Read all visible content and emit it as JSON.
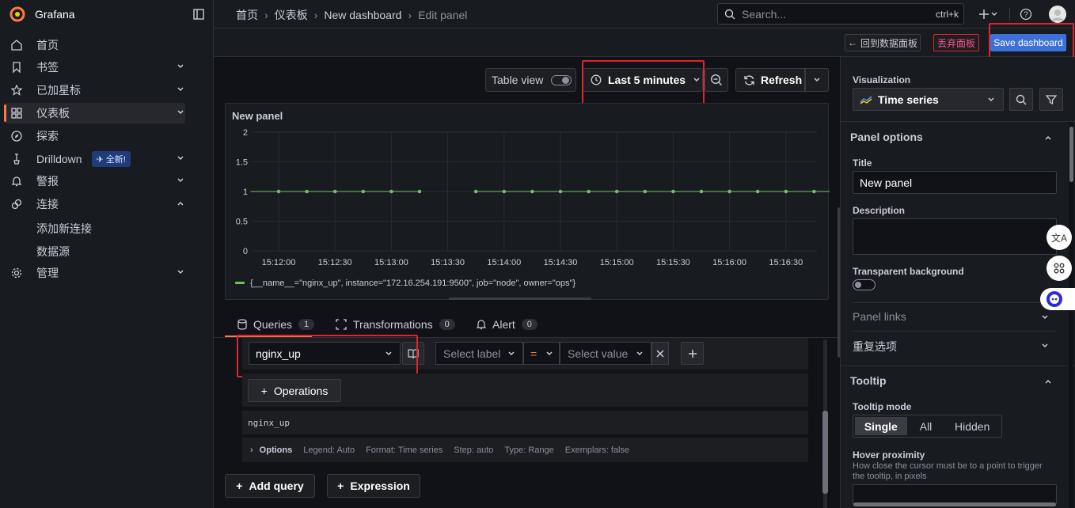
{
  "app": {
    "name": "Grafana"
  },
  "sidebar": {
    "items": [
      {
        "label": "首页",
        "icon": "home-icon"
      },
      {
        "label": "书签",
        "icon": "bookmark-icon"
      },
      {
        "label": "已加星标",
        "icon": "star-icon"
      },
      {
        "label": "仪表板",
        "icon": "dashboards-icon"
      },
      {
        "label": "探索",
        "icon": "compass-icon"
      },
      {
        "label": "Drilldown",
        "icon": "drilldown-icon",
        "badge": "全新!"
      },
      {
        "label": "警报",
        "icon": "bell-icon"
      },
      {
        "label": "连接",
        "icon": "link-icon"
      },
      {
        "label": "管理",
        "icon": "gear-icon"
      }
    ],
    "sub_items": [
      "添加新连接",
      "数据源"
    ]
  },
  "breadcrumb": [
    "首页",
    "仪表板",
    "New dashboard",
    "Edit panel"
  ],
  "search": {
    "placeholder": "Search...",
    "shortcut": "ctrl+k"
  },
  "toolbar": {
    "back_label": "回到数据面板",
    "discard_label": "丢弃面板",
    "save_label": "Save dashboard"
  },
  "panel_toolbar": {
    "table_view_label": "Table view",
    "time_range": "Last 5 minutes",
    "refresh_label": "Refresh"
  },
  "panel": {
    "title": "New panel"
  },
  "chart_data": {
    "type": "line",
    "title": "New panel",
    "x_ticks": [
      "15:12:00",
      "15:12:30",
      "15:13:00",
      "15:13:30",
      "15:14:00",
      "15:14:30",
      "15:15:00",
      "15:15:30",
      "15:16:00",
      "15:16:30"
    ],
    "y_ticks": [
      "0",
      "0.5",
      "1",
      "1.5",
      "2"
    ],
    "ylim": [
      0,
      2
    ],
    "series": [
      {
        "name": "{__name__=\"nginx_up\", instance=\"172.16.254.191:9500\", job=\"node\", owner=\"ops\"}",
        "color": "#73bf69",
        "segments": [
          {
            "x": [
              "15:11:45",
              "15:12:00",
              "15:12:15",
              "15:12:30",
              "15:12:45",
              "15:13:00",
              "15:13:15"
            ],
            "y": [
              1,
              1,
              1,
              1,
              1,
              1,
              1
            ]
          },
          {
            "x": [
              "15:13:45",
              "15:14:00",
              "15:14:15",
              "15:14:30",
              "15:14:45",
              "15:15:00",
              "15:15:15",
              "15:15:30",
              "15:15:45",
              "15:16:00",
              "15:16:15",
              "15:16:30",
              "15:16:45",
              "15:17:00"
            ],
            "y": [
              1,
              1,
              1,
              1,
              1,
              1,
              1,
              1,
              1,
              1,
              1,
              1,
              1,
              1
            ]
          }
        ]
      }
    ],
    "grid": true,
    "legend": "bottom-left"
  },
  "query_tabs": [
    {
      "label": "Queries",
      "count": "1"
    },
    {
      "label": "Transformations",
      "count": "0"
    },
    {
      "label": "Alert",
      "count": "0"
    }
  ],
  "query": {
    "metric": "nginx_up",
    "label_placeholder": "Select label",
    "operator": "=",
    "value_placeholder": "Select value",
    "operations_label": "Operations",
    "raw": "nginx_up",
    "options_label": "Options",
    "options_summary": [
      "Legend: Auto",
      "Format: Time series",
      "Step: auto",
      "Type: Range",
      "Exemplars: false"
    ]
  },
  "add_query_label": "Add query",
  "expression_label": "Expression",
  "right_pane": {
    "visualization_label": "Visualization",
    "visualization_value": "Time series",
    "panel_options_title": "Panel options",
    "title_label": "Title",
    "title_value": "New panel",
    "description_label": "Description",
    "transparent_label": "Transparent background",
    "panel_links_label": "Panel links",
    "repeat_label": "重复选项",
    "tooltip_title": "Tooltip",
    "tooltip_mode_label": "Tooltip mode",
    "tooltip_modes": [
      "Single",
      "All",
      "Hidden"
    ],
    "hover_label": "Hover proximity",
    "hover_desc": "How close the cursor must be to a point to trigger the tooltip, in pixels"
  },
  "colors": {
    "accent": "#3d71d9",
    "series": "#73bf69",
    "highlight": "#e0242c",
    "brand": "#ff7941"
  }
}
